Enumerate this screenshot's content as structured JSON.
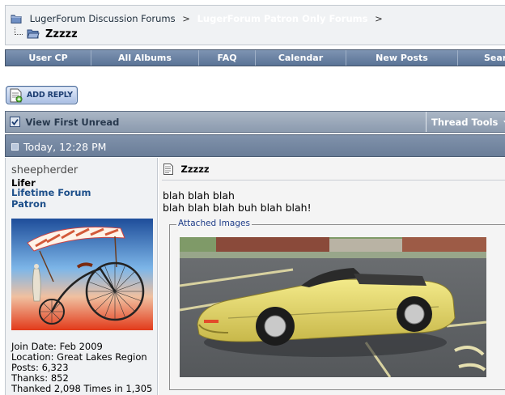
{
  "breadcrumb": {
    "forum_home": "LugerForum Discussion Forums",
    "separator": ">",
    "patron_forums": "LugerForum Patron Only Forums",
    "current_thread": "Zzzzz"
  },
  "navbar": {
    "items": [
      "User CP",
      "All Albums",
      "FAQ",
      "Calendar",
      "New Posts",
      "Search"
    ]
  },
  "buttons": {
    "add_reply": "ADD REPLY"
  },
  "thread_controls": {
    "view_first_unread": "View First Unread",
    "thread_tools": "Thread Tools"
  },
  "post": {
    "date": "Today, 12:28 PM",
    "title": "Zzzzz",
    "message_line1": "blah blah blah",
    "message_line2": "blah blah blah buh blah blah!",
    "attached_images_label": "Attached Images"
  },
  "user": {
    "username": "sheepherder",
    "title": "Lifer",
    "rank": "Lifetime Forum Patron",
    "join_date": "Join Date: Feb 2009",
    "location": "Location: Great Lakes Region",
    "posts": "Posts: 6,323",
    "thanks": "Thanks: 852",
    "thanked": "Thanked 2,098 Times in 1,305"
  },
  "icons": {
    "breadcrumb_folder": "folder-icon",
    "thread_folder": "folder-open-icon",
    "add_reply": "document-plus-icon",
    "view_first_unread": "checkbox-icon",
    "thread_tools_menu": "caret-down-icon",
    "post_status": "post-old-icon",
    "post_title": "document-icon"
  },
  "colors": {
    "navbar": "#6a82a4",
    "control_bar": "#9aa7b8",
    "post_header": "#7487a1",
    "rank_link": "#1d4f8a",
    "user_panel": "#f0f2f4"
  }
}
